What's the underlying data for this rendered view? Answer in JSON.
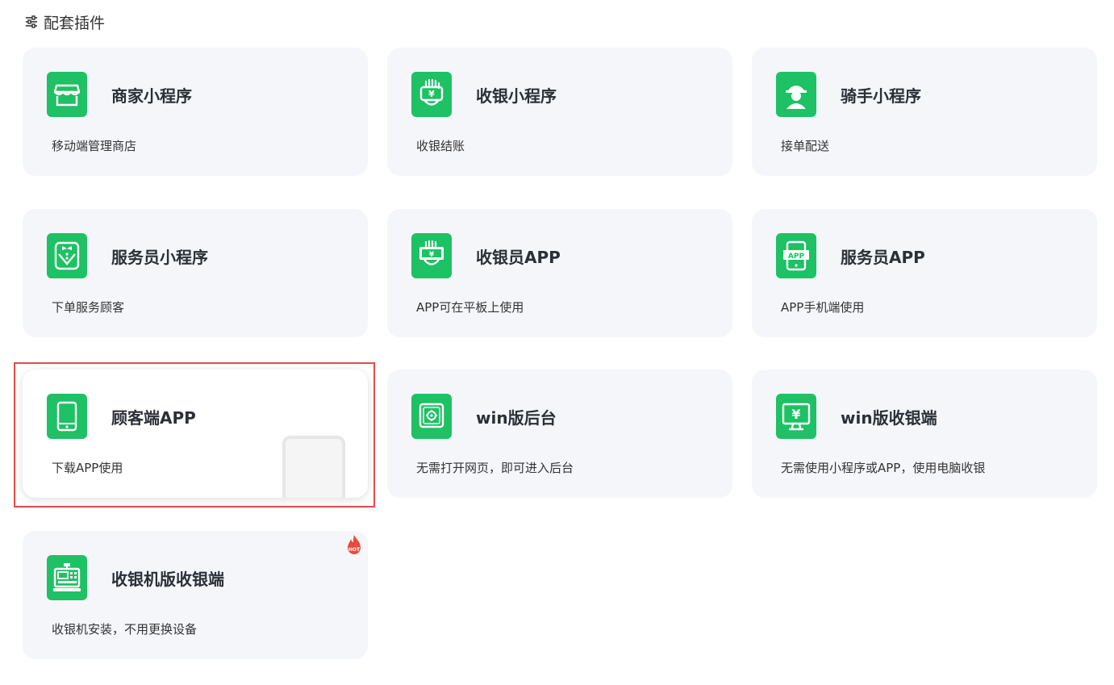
{
  "header": {
    "icon": "sliders-icon",
    "title": "配套插件"
  },
  "accent_color": "#1ec164",
  "highlight_color": "#e84a4a",
  "plugins": [
    {
      "name": "商家小程序",
      "desc": "移动端管理商店",
      "icon": "storefront-icon"
    },
    {
      "name": "收银小程序",
      "desc": "收银结账",
      "icon": "cashier-hand-icon"
    },
    {
      "name": "骑手小程序",
      "desc": "接单配送",
      "icon": "rider-icon"
    },
    {
      "name": "服务员小程序",
      "desc": "下单服务顾客",
      "icon": "waiter-icon"
    },
    {
      "name": "收银员APP",
      "desc": "APP可在平板上使用",
      "icon": "cashier-tablet-icon"
    },
    {
      "name": "服务员APP",
      "desc": "APP手机端使用",
      "icon": "phone-app-icon",
      "icon_text": "APP"
    },
    {
      "name": "顾客端APP",
      "desc": "下载APP使用",
      "icon": "tablet-icon",
      "selected": true
    },
    {
      "name": "win版后台",
      "desc": "无需打开网页，即可进入后台",
      "icon": "settings-window-icon"
    },
    {
      "name": "win版收银端",
      "desc": "无需使用小程序或APP，使用电脑收银",
      "icon": "monitor-yen-icon"
    },
    {
      "name": "收银机版收银端",
      "desc": "收银机安装，不用更换设备",
      "icon": "cash-register-icon",
      "badge": "HOT"
    }
  ]
}
